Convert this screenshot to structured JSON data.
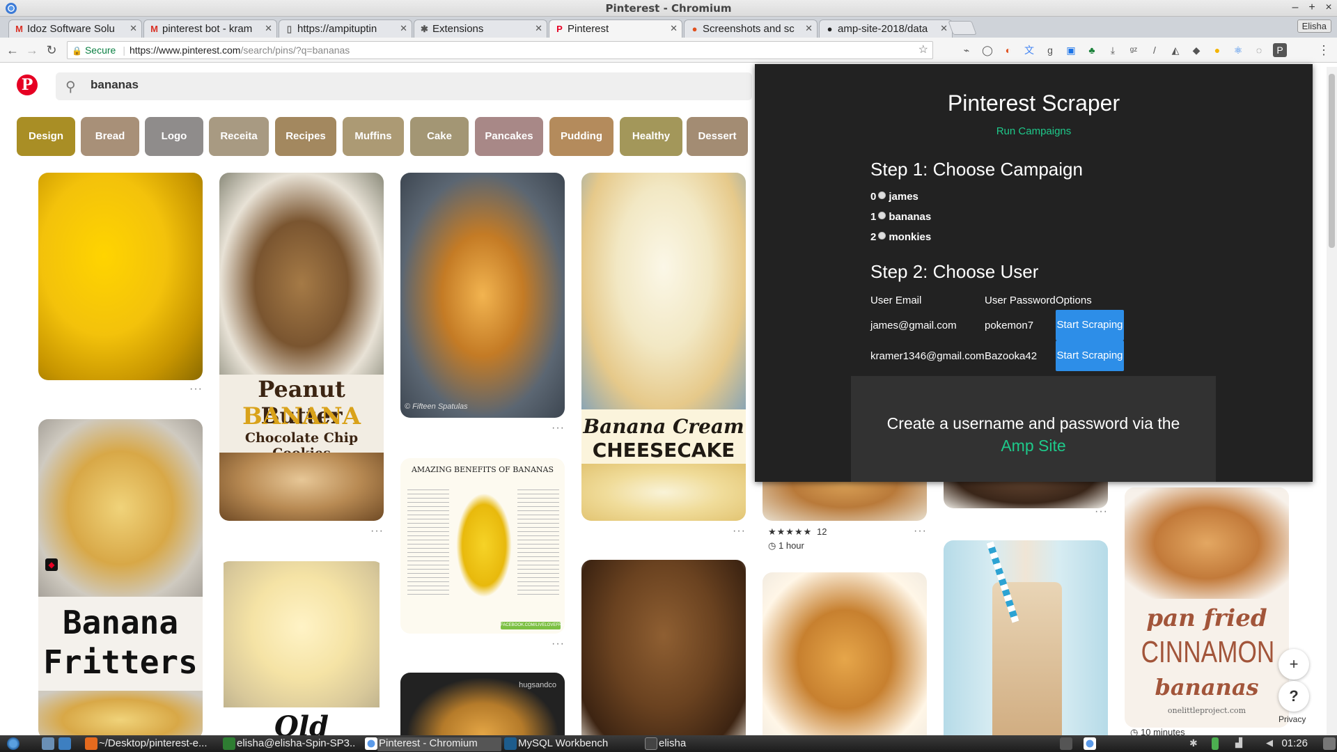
{
  "window": {
    "title": "Pinterest - Chromium",
    "profile": "Elisha",
    "controls": [
      "–",
      "+",
      "×"
    ]
  },
  "tabs": [
    {
      "label": "Idoz Software Solu",
      "favicon": "M",
      "fav_color": "#d93025"
    },
    {
      "label": "pinterest bot - kram",
      "favicon": "M",
      "fav_color": "#d93025"
    },
    {
      "label": "https://ampituptin",
      "favicon": "▯",
      "fav_color": "#666666"
    },
    {
      "label": "Extensions",
      "favicon": "✱",
      "fav_color": "#555555"
    },
    {
      "label": "Pinterest",
      "favicon": "P",
      "fav_color": "#e60023",
      "active": true
    },
    {
      "label": "Screenshots and sc",
      "favicon": "●",
      "fav_color": "#e0501e"
    },
    {
      "label": "amp-site-2018/data",
      "favicon": "●",
      "fav_color": "#222222"
    }
  ],
  "toolbar": {
    "secure_label": "Secure",
    "url_host": "https://www.pinterest.com",
    "url_path": "/search/pins/?q=bananas"
  },
  "pinterest": {
    "search_value": "bananas",
    "chips": [
      {
        "label": "Design",
        "color": "#a98e25"
      },
      {
        "label": "Bread",
        "color": "#a89078"
      },
      {
        "label": "Logo",
        "color": "#8f8c8b"
      },
      {
        "label": "Receita",
        "color": "#a89a82"
      },
      {
        "label": "Recipes",
        "color": "#a3885f"
      },
      {
        "label": "Muffins",
        "color": "#ac9a74"
      },
      {
        "label": "Cake",
        "color": "#a39674"
      },
      {
        "label": "Pancakes",
        "color": "#a88887"
      },
      {
        "label": "Pudding",
        "color": "#b48b5c"
      },
      {
        "label": "Healthy",
        "color": "#a3975a"
      },
      {
        "label": "Dessert",
        "color": "#a38c73"
      }
    ],
    "pin_texts": {
      "cookies_line1": "Peanut Butter",
      "cookies_line2": "BANANA",
      "cookies_line3": "Chocolate Chip Cookies",
      "cheesecake_line1": "Banana Cream",
      "cheesecake_line2": "CHEESECAKE",
      "benefits_title": "AMAZING BENEFITS OF BANANAS",
      "fritters_line1": "Banana",
      "fritters_line2": "Fritters",
      "watermark": "© Fifteen Spatulas",
      "cinnamon_line1": "pan fried",
      "cinnamon_line2": "CINNAMON",
      "cinnamon_line3": "bananas",
      "cinnamon_site": "onelittleproject.com",
      "hugs_credit": "hugsandco",
      "facebook_tag": "FACEBOOK.COM/LIVELOVEFRUIT"
    },
    "rating_count": "12",
    "rating_stars": "★★★★★",
    "time_label": "1 hour",
    "time_label_2": "10 minutes",
    "privacy": "Privacy",
    "plus": "+",
    "help": "?"
  },
  "scraper": {
    "title": "Pinterest Scraper",
    "run_link": "Run Campaigns",
    "step1": "Step 1: Choose Campaign",
    "campaigns": [
      {
        "index": "0",
        "name": "james"
      },
      {
        "index": "1",
        "name": "bananas"
      },
      {
        "index": "2",
        "name": "monkies"
      }
    ],
    "step2": "Step 2: Choose User",
    "headers": {
      "email": "User Email",
      "password": "User Password",
      "options": "Options"
    },
    "users": [
      {
        "email": "james@gmail.com",
        "password": "pokemon7",
        "action": "Start Scraping"
      },
      {
        "email": "kramer1346@gmail.com",
        "password": "Bazooka42",
        "action": "Start Scraping"
      }
    ],
    "amp_text": "Create a username and password via the",
    "amp_link": "Amp Site"
  },
  "taskbar": {
    "items": [
      {
        "label": "~/Desktop/pinterest-e..."
      },
      {
        "label": "elisha@elisha-Spin-SP3..."
      },
      {
        "label": "Pinterest - Chromium",
        "active": true
      },
      {
        "label": "MySQL Workbench"
      },
      {
        "label": "elisha"
      }
    ],
    "clock": "01:26"
  }
}
